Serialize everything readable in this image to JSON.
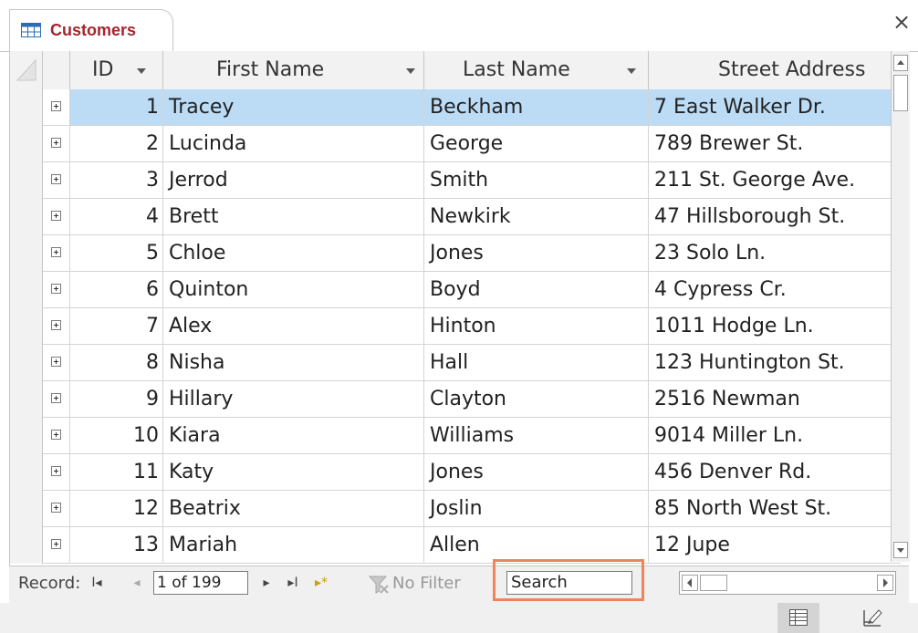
{
  "tab": {
    "icon": "table-icon",
    "title": "Customers",
    "close_glyph": "×"
  },
  "columns": [
    {
      "key": "id",
      "label": "ID",
      "has_dropdown": true
    },
    {
      "key": "first_name",
      "label": "First Name",
      "has_dropdown": true
    },
    {
      "key": "last_name",
      "label": "Last Name",
      "has_dropdown": true
    },
    {
      "key": "street_address",
      "label": "Street Address",
      "has_dropdown": false
    }
  ],
  "rows": [
    {
      "id": "1",
      "first_name": "Tracey",
      "last_name": "Beckham",
      "street_address": "7 East Walker Dr.",
      "selected": true
    },
    {
      "id": "2",
      "first_name": "Lucinda",
      "last_name": "George",
      "street_address": "789 Brewer St."
    },
    {
      "id": "3",
      "first_name": "Jerrod",
      "last_name": "Smith",
      "street_address": "211 St. George Ave."
    },
    {
      "id": "4",
      "first_name": "Brett",
      "last_name": "Newkirk",
      "street_address": "47 Hillsborough St."
    },
    {
      "id": "5",
      "first_name": "Chloe",
      "last_name": "Jones",
      "street_address": "23 Solo Ln."
    },
    {
      "id": "6",
      "first_name": "Quinton",
      "last_name": "Boyd",
      "street_address": "4 Cypress Cr."
    },
    {
      "id": "7",
      "first_name": "Alex",
      "last_name": "Hinton",
      "street_address": "1011 Hodge Ln."
    },
    {
      "id": "8",
      "first_name": "Nisha",
      "last_name": "Hall",
      "street_address": "123 Huntington St."
    },
    {
      "id": "9",
      "first_name": "Hillary",
      "last_name": "Clayton",
      "street_address": "2516 Newman"
    },
    {
      "id": "10",
      "first_name": "Kiara",
      "last_name": "Williams",
      "street_address": "9014 Miller Ln."
    },
    {
      "id": "11",
      "first_name": "Katy",
      "last_name": "Jones",
      "street_address": "456 Denver Rd."
    },
    {
      "id": "12",
      "first_name": "Beatrix",
      "last_name": "Joslin",
      "street_address": "85 North West St."
    },
    {
      "id": "13",
      "first_name": "Mariah",
      "last_name": "Allen",
      "street_address": "12 Jupe"
    }
  ],
  "nav": {
    "record_label": "Record:",
    "record_position": "1 of 199",
    "first_glyph": "I◂",
    "prev_glyph": "◂",
    "next_glyph": "▸",
    "last_glyph": "▸I",
    "new_glyph": "▸*",
    "filter_label": "No Filter",
    "search_value": "Search"
  },
  "colors": {
    "tab_title": "#a4262c",
    "selected_row": "#bcdcf6",
    "search_highlight": "#f0845a",
    "header_bg": "#f2f2f2"
  }
}
